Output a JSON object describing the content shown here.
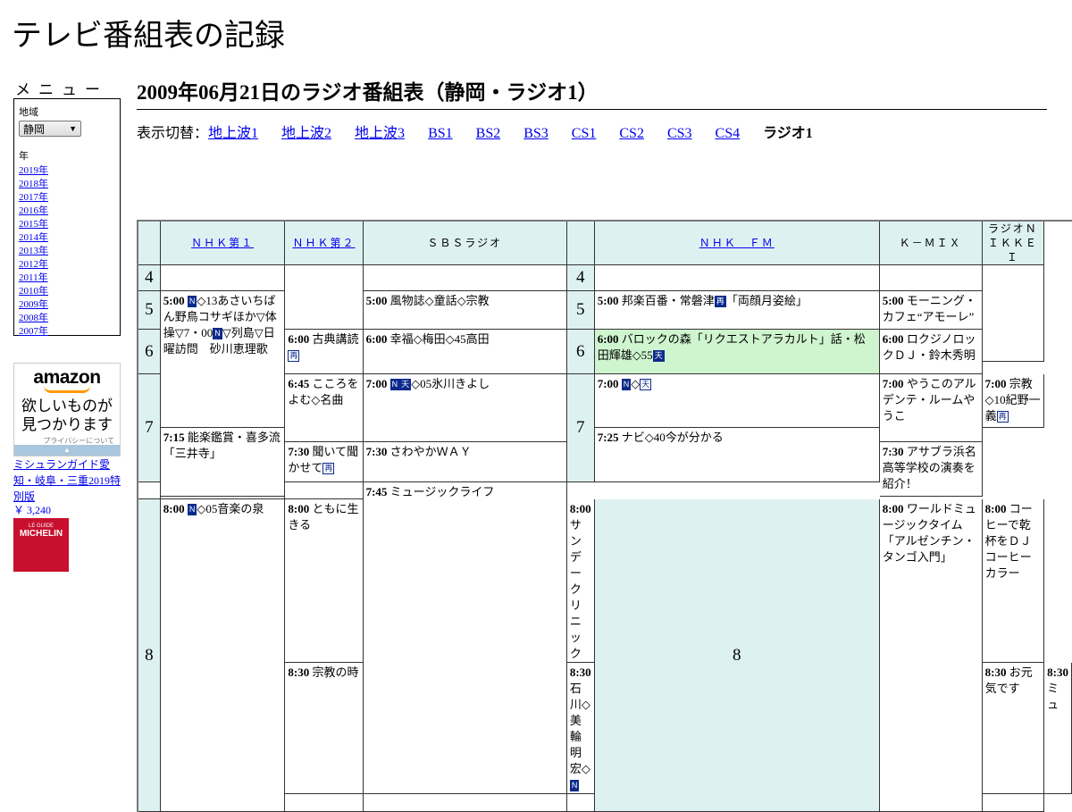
{
  "site": {
    "title": "テレビ番組表の記録"
  },
  "menu": {
    "heading": "メニュー",
    "region_label": "地域",
    "region_value": "静岡",
    "year_label": "年",
    "years": [
      "2019年",
      "2018年",
      "2017年",
      "2016年",
      "2015年",
      "2014年",
      "2013年",
      "2012年",
      "2011年",
      "2010年",
      "2009年",
      "2008年",
      "2007年"
    ]
  },
  "ad": {
    "logo": "amazon",
    "line1": "欲しいものが",
    "line2": "見つかります",
    "privacy": "プライバシーについて",
    "book_title": "ミシュランガイド愛知・岐阜・三重2019特別版",
    "book_price": "￥ 3,240",
    "cover_small": "LE GUIDE",
    "cover_big": "MICHELIN"
  },
  "main": {
    "heading": "2009年06月21日のラジオ番組表（静岡・ラジオ1）",
    "switch_label": "表示切替：",
    "switch_links": [
      "地上波1",
      "地上波2",
      "地上波3",
      "BS1",
      "BS2",
      "BS3",
      "CS1",
      "CS2",
      "CS3",
      "CS4"
    ],
    "switch_current": "ラジオ1"
  },
  "schedule": {
    "hours": [
      "4",
      "5",
      "6",
      "7",
      "8"
    ],
    "channels": [
      "ＮＨＫ第１",
      "ＮＨＫ第２",
      "ＳＢＳラジオ",
      "ＮＨＫ　ＦＭ",
      "Ｋ－ＭＩＸ",
      "ラジオＮＩＫＫＥＩ"
    ],
    "icons": {
      "news": "N",
      "weather": "天",
      "rerun": "再"
    },
    "p": {
      "nhk1_500_t": "5:00",
      "nhk1_500_a": "◇13あさいちばん野鳥コサギほか▽体操▽7・00",
      "nhk1_500_b": "▽列島▽日曜訪問　砂川恵理歌",
      "nhk1_800_t": "8:00",
      "nhk1_800_a": "◇05音楽の泉",
      "nhk2_600_t": "6:00",
      "nhk2_600_a": "古典講読",
      "nhk2_645_t": "6:45",
      "nhk2_645_a": "こころをよむ◇名曲",
      "nhk2_730_t": "7:30",
      "nhk2_730_a": "聞いて聞かせて",
      "nhk2_800_t": "8:00",
      "nhk2_800_a": "ともに生きる",
      "nhk2_830_t": "8:30",
      "nhk2_830_a": "宗教の時",
      "sbs_500_t": "5:00",
      "sbs_500_a": "風物誌◇童話◇宗教",
      "sbs_600_t": "6:00",
      "sbs_600_a": "幸福◇梅田◇45高田",
      "sbs_700_t": "7:00",
      "sbs_700_a": "◇05氷川きよし",
      "sbs_730_t": "7:30",
      "sbs_730_a": "さわやかＷＡＹ",
      "sbs_800_t": "8:00",
      "sbs_800_a": "サンデークリニック",
      "sbs_830_t": "8:30",
      "sbs_830_a": "石川◇美輪明宏◇",
      "fm_500_t": "5:00",
      "fm_500_a": "邦楽百番・常磐津",
      "fm_500_b": "「両顔月姿絵」",
      "fm_600_t": "6:00",
      "fm_600_a": "バロックの森「リクエストアラカルト」話・松田輝雄◇55",
      "fm_700_t": "7:00",
      "fm_700_a": "◇",
      "fm_715_t": "7:15",
      "fm_715_a": "能楽鑑賞・喜多流「三井寺」",
      "fm_800_t": "8:00",
      "fm_800_a": "ワールドミュージックタイム「アルゼンチン・タンゴ入門」",
      "kmix_500_t": "5:00",
      "kmix_500_a": "モーニング・カフェ“アモーレ”",
      "kmix_600_t": "6:00",
      "kmix_600_a": "ロクジノロックＤＪ・鈴木秀明",
      "kmix_700_t": "7:00",
      "kmix_700_a": "やうこのアルデンテ・ルームやうこ",
      "kmix_730_t": "7:30",
      "kmix_730_a": "アサブラ浜名高等学校の演奏を紹介！",
      "kmix_800_t": "8:00",
      "kmix_800_a": "コーヒーで乾杯をＤＪコーヒーカラー",
      "kmix_830_t": "8:30",
      "kmix_830_a": "お元気です",
      "nik_700_t": "7:00",
      "nik_700_a": "宗教◇10紀野一義",
      "nik_725_t": "7:25",
      "nik_725_a": "ナビ◇40今が分かる",
      "nik_745_t": "7:45",
      "nik_745_a": "ミュージックライフ",
      "nik_830_t": "8:30",
      "nik_830_a": "ミュ"
    }
  }
}
